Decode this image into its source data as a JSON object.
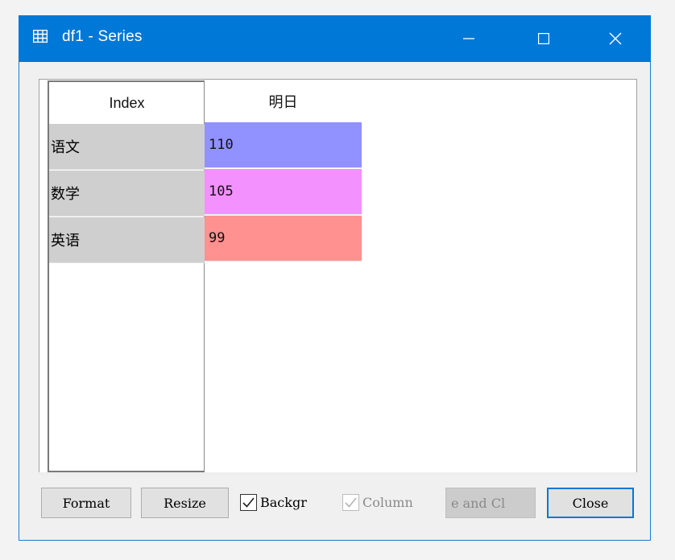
{
  "window": {
    "title": "df1 - Series",
    "accent_color": "#0078d7",
    "icons": {
      "app": "table-grid-icon",
      "minimize": "minimize-icon",
      "maximize": "maximize-icon",
      "close": "close-icon"
    }
  },
  "table": {
    "index_header": "Index",
    "column_header": "明日",
    "rows": [
      {
        "index": "语文",
        "value": "110",
        "color": "#9191ff"
      },
      {
        "index": "数学",
        "value": "105",
        "color": "#f291ff"
      },
      {
        "index": "英语",
        "value": "99",
        "color": "#ff9191"
      }
    ],
    "index_bg_color": "#cfcfcf"
  },
  "footer": {
    "format_label": "Format",
    "resize_label": "Resize",
    "background_label": "Backgr",
    "background_checked": true,
    "column_label": "Column",
    "column_checked": true,
    "column_enabled": false,
    "save_close_label": "e and Cl",
    "close_label": "Close"
  }
}
